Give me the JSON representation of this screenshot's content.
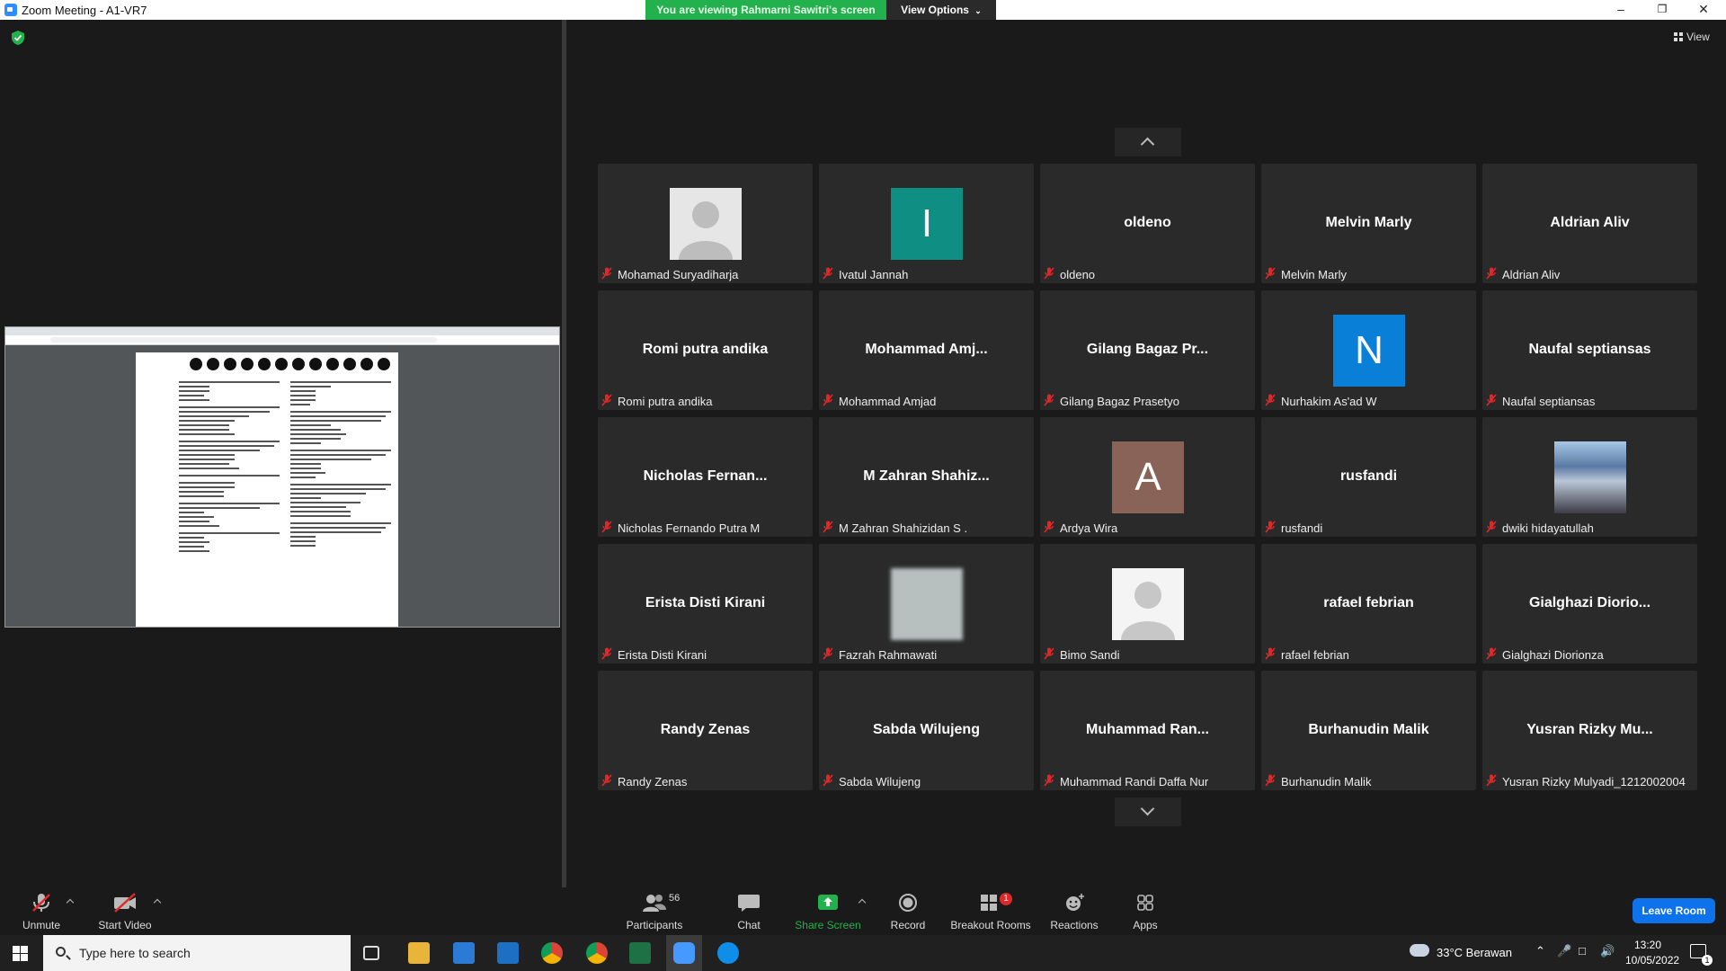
{
  "window": {
    "title": "Zoom Meeting - A1-VR7",
    "share_banner": "You are viewing Rahmarni Sawitri's screen",
    "view_options": "View Options"
  },
  "gallery": {
    "view_label": "View",
    "tiles": [
      {
        "big": "",
        "label": "Mohamad Suryadiharja",
        "avatar": "person-grey"
      },
      {
        "big": "",
        "label": "Ivatul Jannah",
        "avatar": "letter",
        "letter": "I",
        "color": "#0f8f84"
      },
      {
        "big": "oldeno",
        "label": "oldeno"
      },
      {
        "big": "Melvin Marly",
        "label": "Melvin Marly"
      },
      {
        "big": "Aldrian Aliv",
        "label": "Aldrian Aliv"
      },
      {
        "big": "Romi putra andika",
        "label": "Romi putra andika"
      },
      {
        "big": "Mohammad  Amj...",
        "label": "Mohammad Amjad"
      },
      {
        "big": "Gilang Bagaz Pr...",
        "label": "Gilang Bagaz Prasetyo"
      },
      {
        "big": "",
        "label": "Nurhakim As'ad W",
        "avatar": "letter",
        "letter": "N",
        "color": "#0a7fd8"
      },
      {
        "big": "Naufal septiansas",
        "label": "Naufal septiansas"
      },
      {
        "big": "Nicholas  Fernan...",
        "label": "Nicholas Fernando Putra M"
      },
      {
        "big": "M  Zahran  Shahiz...",
        "label": "M Zahran Shahizidan S ."
      },
      {
        "big": "",
        "label": "Ardya Wira",
        "avatar": "letter",
        "letter": "A",
        "color": "#8a6358"
      },
      {
        "big": "rusfandi",
        "label": "rusfandi"
      },
      {
        "big": "",
        "label": "dwiki hidayatullah",
        "avatar": "photo"
      },
      {
        "big": "Erista Disti Kirani",
        "label": "Erista Disti Kirani"
      },
      {
        "big": "",
        "label": "Fazrah Rahmawati",
        "avatar": "blurred"
      },
      {
        "big": "",
        "label": "Bimo Sandi",
        "avatar": "person-white"
      },
      {
        "big": "rafael febrian",
        "label": "rafael febrian"
      },
      {
        "big": "Gialghazi  Diorio...",
        "label": "Gialghazi Diorionza"
      },
      {
        "big": "Randy Zenas",
        "label": "Randy Zenas"
      },
      {
        "big": "Sabda Wilujeng",
        "label": "Sabda Wilujeng"
      },
      {
        "big": "Muhammad  Ran...",
        "label": "Muhammad Randi Daffa Nur"
      },
      {
        "big": "Burhanudin Malik",
        "label": "Burhanudin Malik"
      },
      {
        "big": "Yusran Rizky Mu...",
        "label": "Yusran Rizky Mulyadi_1212002004"
      }
    ]
  },
  "toolbar": {
    "unmute": "Unmute",
    "start_video": "Start Video",
    "participants": "Participants",
    "participants_count": "56",
    "chat": "Chat",
    "share_screen": "Share Screen",
    "record": "Record",
    "breakout_rooms": "Breakout Rooms",
    "breakout_badge": "1",
    "reactions": "Reactions",
    "apps": "Apps",
    "leave": "Leave Room"
  },
  "taskbar": {
    "search_placeholder": "Type here to search",
    "weather": "33°C  Berawan",
    "time": "13:20",
    "date": "10/05/2022",
    "notifications": "1"
  },
  "colors": {
    "share_green": "#23b14d",
    "leave_blue": "#0e72ed",
    "mute_red": "#e02828"
  }
}
